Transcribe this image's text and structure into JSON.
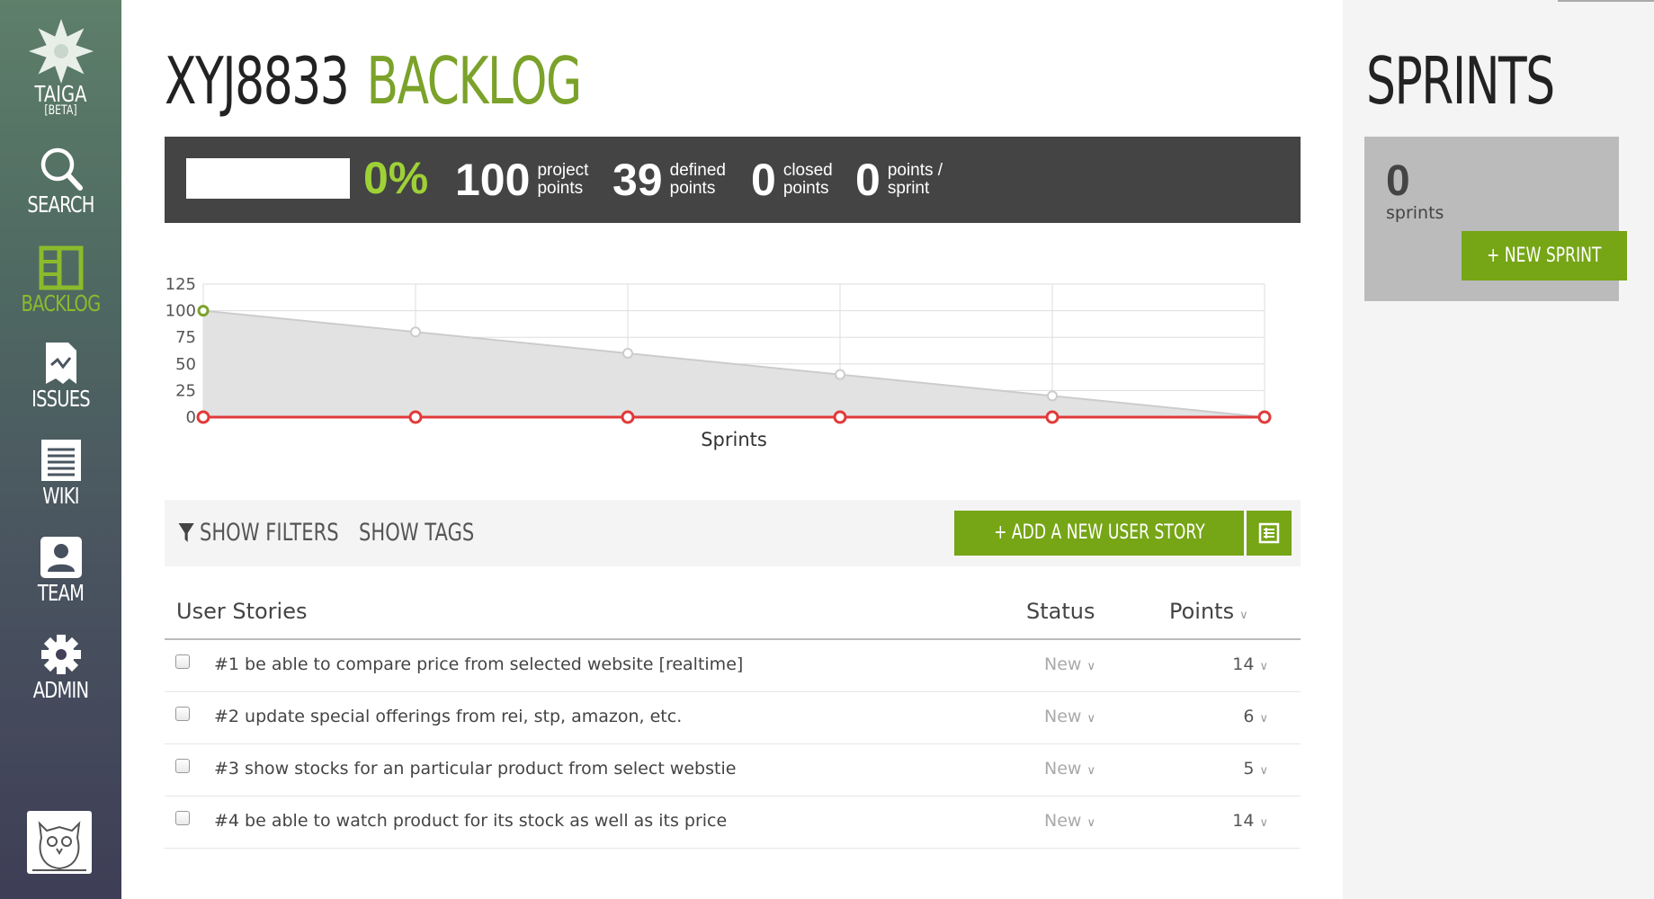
{
  "sidebar": {
    "logo": {
      "text": "TAIGA",
      "badge": "[BETA]"
    },
    "items": [
      {
        "label": "SEARCH",
        "icon": "search-icon"
      },
      {
        "label": "BACKLOG",
        "icon": "backlog-icon",
        "active": true
      },
      {
        "label": "ISSUES",
        "icon": "issues-icon"
      },
      {
        "label": "WIKI",
        "icon": "wiki-icon"
      },
      {
        "label": "TEAM",
        "icon": "team-icon"
      },
      {
        "label": "ADMIN",
        "icon": "gear-icon"
      }
    ]
  },
  "header": {
    "project": "XYJ8833",
    "section": "BACKLOG"
  },
  "summary": {
    "progress_fraction": 0,
    "percent": "0%",
    "stats": [
      {
        "value": "100",
        "label_line1": "project",
        "label_line2": "points"
      },
      {
        "value": "39",
        "label_line1": "defined",
        "label_line2": "points"
      },
      {
        "value": "0",
        "label_line1": "closed",
        "label_line2": "points"
      },
      {
        "value": "0",
        "label_line1": "points /",
        "label_line2": "sprint"
      }
    ]
  },
  "chart_data": {
    "type": "line",
    "xlabel": "Sprints",
    "ylabel": "",
    "ylim": [
      0,
      125
    ],
    "yticks": [
      0,
      25,
      50,
      75,
      100,
      125
    ],
    "x": [
      0,
      1,
      2,
      3,
      4,
      5
    ],
    "grid": true,
    "series": [
      {
        "values": [
          100,
          80,
          60,
          40,
          20,
          0
        ],
        "color": "#cccccc",
        "fill": "#e2e2e2"
      },
      {
        "values": [
          0,
          0,
          0,
          0,
          0,
          0
        ],
        "color": "#e03a3a"
      }
    ],
    "start_marker_color": "#7ba22a"
  },
  "filters": {
    "show_filters": "SHOW FILTERS",
    "show_tags": "SHOW TAGS",
    "add_story": "+ ADD A NEW USER STORY"
  },
  "table": {
    "headers": {
      "stories": "User Stories",
      "status": "Status",
      "points": "Points"
    },
    "rows": [
      {
        "title": "#1 be able to compare price from selected website [realtime]",
        "status": "New",
        "points": "14"
      },
      {
        "title": "#2 update special offerings from rei, stp, amazon, etc.",
        "status": "New",
        "points": "6"
      },
      {
        "title": "#3 show stocks for an particular product from select webstie",
        "status": "New",
        "points": "5"
      },
      {
        "title": "#4 be able to watch product for its stock as well as its price",
        "status": "New",
        "points": "14"
      }
    ]
  },
  "sprints": {
    "title": "SPRINTS",
    "count": "0",
    "count_label": "sprints",
    "new_sprint": "+ NEW SPRINT"
  },
  "colors": {
    "accent": "#76a516",
    "accent_light": "#9ed136",
    "summary_bg": "#444444",
    "burndown_red": "#e03a3a"
  }
}
